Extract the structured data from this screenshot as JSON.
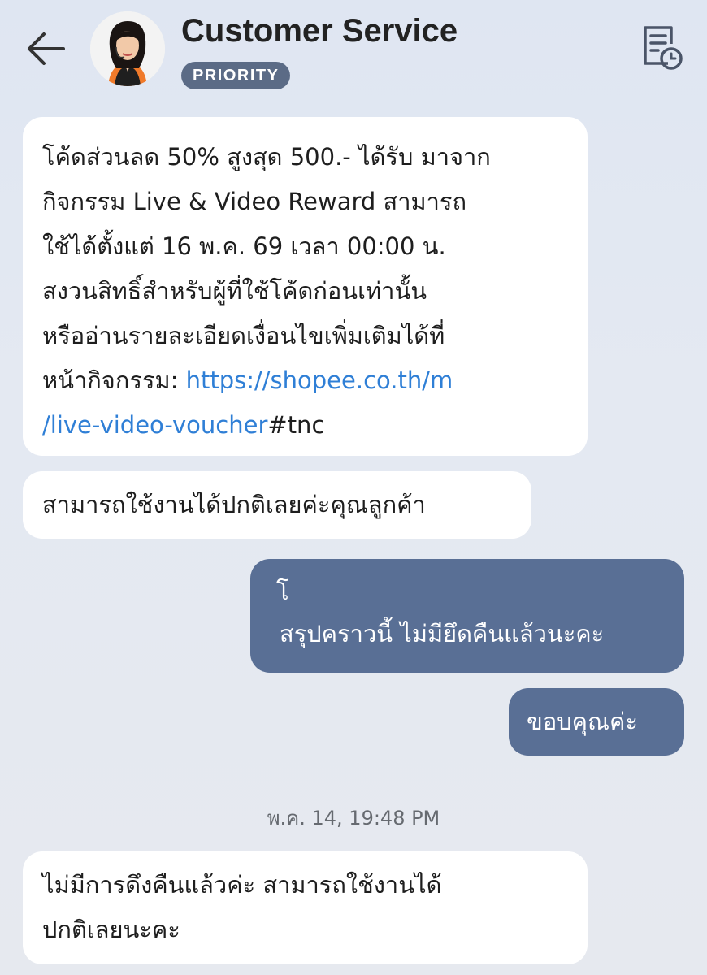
{
  "header": {
    "title": "Customer Service",
    "badge": "PRIORITY"
  },
  "messages": [
    {
      "from": "agent",
      "lines": [
        "โค้ดส่วนลด 50% สูงสุด 500.- ได้รับ มาจาก",
        "กิจกรรม Live & Video Reward สามารถ",
        "ใช้ได้ตั้งแต่ 16 พ.ค. 69 เวลา 00:00 น.",
        "สงวนสิทธิ์สำหรับผู้ที่ใช้โค้ดก่อนเท่านั้น",
        "หรืออ่านรายละเอียดเงื่อนไขเพิ่มเติมได้ที่"
      ],
      "line6_prefix": "หน้ากิจกรรม: ",
      "link_part1": "https://shopee.co.th/m",
      "link_part2": "/live-video-voucher",
      "link_suffix": "#tnc"
    },
    {
      "from": "agent",
      "text": "สามารถใช้งานได้ปกติเลยค่ะคุณลูกค้า"
    },
    {
      "from": "user",
      "lines": [
        "โ",
        "สรุปคราวนี้ ไม่มียึดคืนแล้วนะคะ"
      ]
    },
    {
      "from": "user",
      "text": "ขอบคุณค่ะ"
    },
    {
      "from": "agent",
      "lines": [
        "ไม่มีการดึงคืนแล้วค่ะ สามารถใช้งานได้",
        "ปกติเลยนะคะ"
      ]
    }
  ],
  "timestamp": "พ.ค. 14, 19:48 PM",
  "icons": {
    "back": "arrow-left-icon",
    "history": "document-clock-icon"
  },
  "colors": {
    "outgoing_bubble": "#596f95",
    "incoming_bubble": "#ffffff",
    "link": "#2f7fd6",
    "badge": "#5b6b86"
  }
}
